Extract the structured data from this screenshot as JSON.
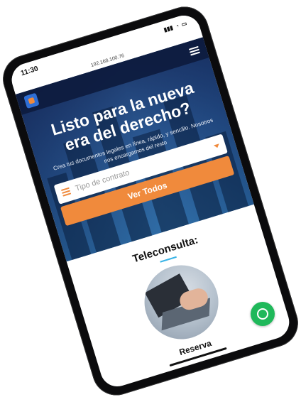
{
  "statusbar": {
    "time": "11:30"
  },
  "browser": {
    "url": "192.168.100.76"
  },
  "hero": {
    "title": "Listo para la nueva era del derecho?",
    "subtitle": "Crea tus documentos legales en línea, rápido, y sencillo. Nosotros nos encargamos del resto"
  },
  "search": {
    "placeholder": "Tipo de contrato",
    "button_label": "Ver Todos"
  },
  "section": {
    "title": "Teleconsulta:",
    "card_label": "Reserva"
  },
  "colors": {
    "accent": "#f08a3c",
    "nav": "#0d1b3e",
    "chat": "#1fb85a",
    "underline": "#38b3e6"
  },
  "icons": {
    "logo": "logo-icon",
    "menu": "menu-icon",
    "list": "list-icon",
    "chat": "chat-icon"
  }
}
